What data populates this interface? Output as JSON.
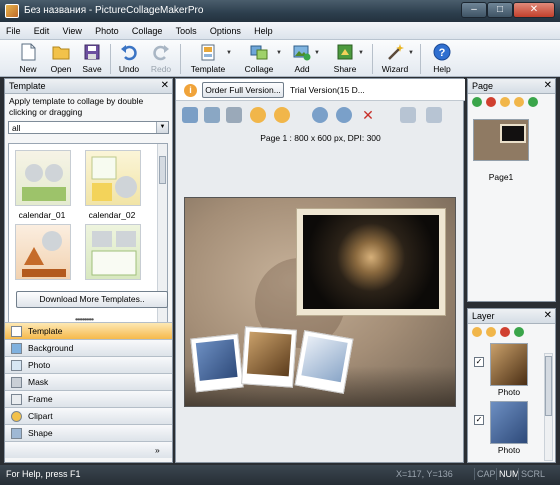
{
  "window": {
    "title": "Без названия - PictureCollageMakerPro",
    "controls": {
      "minimize": "‒",
      "maximize": "□",
      "close": "✕"
    }
  },
  "menu": [
    "File",
    "Edit",
    "View",
    "Photo",
    "Collage",
    "Tools",
    "Options",
    "Help"
  ],
  "toolbar": {
    "new": "New",
    "open": "Open",
    "save": "Save",
    "undo": "Undo",
    "redo": "Redo",
    "template": "Template",
    "collage": "Collage",
    "add": "Add",
    "share": "Share",
    "wizard": "Wizard",
    "help": "Help"
  },
  "template_panel": {
    "title": "Template",
    "close": "✕",
    "hint": "Apply template to collage by double clicking or dragging",
    "filter_value": "all",
    "tiles": [
      {
        "label": "calendar_01"
      },
      {
        "label": "calendar_02"
      },
      {
        "label": ""
      },
      {
        "label": ""
      }
    ],
    "download_button": "Download More Templates..",
    "grip": "••••••••••"
  },
  "nav": [
    "Template",
    "Background",
    "Photo",
    "Mask",
    "Frame",
    "Clipart",
    "Shape"
  ],
  "nav_more": "»",
  "order_bar": {
    "info": "i",
    "button": "Order Full Version...",
    "trial": "Trial Version(15 D..."
  },
  "page_info": "Page 1 : 800 x 600 px, DPI: 300",
  "page_panel": {
    "title": "Page",
    "close": "✕",
    "pages": [
      {
        "label": "Page1"
      }
    ]
  },
  "layer_panel": {
    "title": "Layer",
    "close": "✕",
    "layers": [
      {
        "label": "Photo",
        "checked": "✓"
      },
      {
        "label": "Photo",
        "checked": "✓"
      }
    ]
  },
  "status": {
    "help": "For Help, press F1",
    "coords": "X=117, Y=136",
    "caps": "CAP",
    "num": "NUM",
    "scrl": "SCRL"
  },
  "colors": {
    "accent": "#f6b94b",
    "titlebar": "#2c3e4d",
    "canvas_bg": "#a48e77"
  }
}
